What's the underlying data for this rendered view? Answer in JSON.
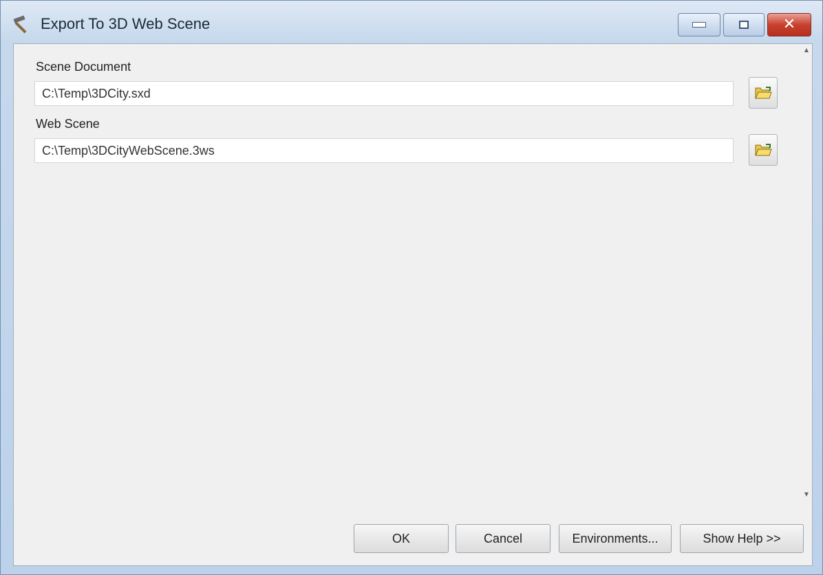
{
  "window": {
    "title": "Export To 3D Web Scene",
    "icon": "hammer-tool-icon"
  },
  "titlebar_controls": {
    "minimize_icon": "minimize-icon",
    "maximize_icon": "maximize-icon",
    "close_icon": "close-icon",
    "close_glyph": "✕"
  },
  "form": {
    "scene_document": {
      "label": "Scene Document",
      "value": "C:\\Temp\\3DCity.sxd",
      "browse_icon": "folder-open-icon"
    },
    "web_scene": {
      "label": "Web Scene",
      "value": "C:\\Temp\\3DCityWebScene.3ws",
      "browse_icon": "folder-open-icon"
    }
  },
  "scrollbar": {
    "up_glyph": "▲",
    "down_glyph": "▼"
  },
  "footer": {
    "ok": "OK",
    "cancel": "Cancel",
    "environments": "Environments...",
    "show_help": "Show Help >>"
  },
  "colors": {
    "window_frame": "#c6d8ec",
    "client_bg": "#f0f0f0",
    "close_button": "#c8412f"
  }
}
